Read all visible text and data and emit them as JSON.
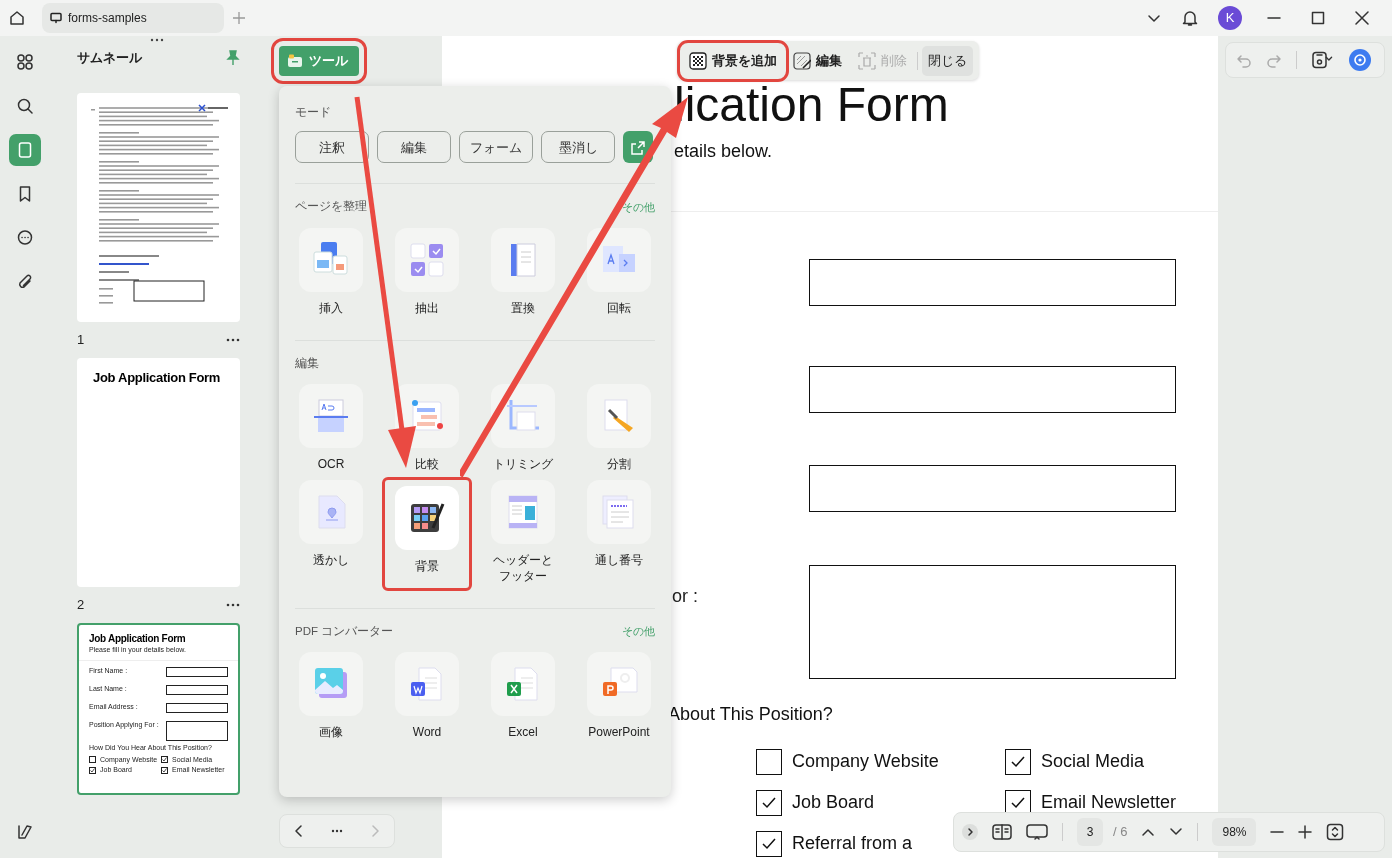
{
  "title_bar": {
    "tab": "forms-samples",
    "avatar": "K"
  },
  "left_rail": [
    {
      "kind": "apps",
      "selected": false
    },
    {
      "kind": "search",
      "selected": false
    },
    {
      "kind": "pages",
      "selected": true
    },
    {
      "kind": "bookmark",
      "selected": false
    },
    {
      "kind": "comment",
      "selected": false
    },
    {
      "kind": "attachment",
      "selected": false
    }
  ],
  "thumbnails": {
    "title": "サムネール",
    "pages": [
      {
        "kind": "contract",
        "number": "1",
        "selected": false
      },
      {
        "kind": "title",
        "number": "2",
        "selected": false,
        "heading": "Job Application Form"
      },
      {
        "kind": "form",
        "selected": true,
        "heading": "Job Application Form",
        "subtitle": "Please fill in your details below.",
        "labels": [
          "First Name :",
          "Last Name :",
          "Email Address :",
          "Position Applying For :"
        ],
        "question": "How Did You Hear About This Position?",
        "options": [
          {
            "label": "Company Website",
            "checked": false
          },
          {
            "label": "Social Media",
            "checked": true
          },
          {
            "label": "Job Board",
            "checked": true
          },
          {
            "label": "Email Newsletter",
            "checked": true
          }
        ]
      }
    ]
  },
  "tool_button": {
    "label": "ツール",
    "highlighted": true
  },
  "tool_panel": {
    "mode_title": "モード",
    "modes": [
      {
        "kind": "text",
        "label": "注釈"
      },
      {
        "kind": "text",
        "label": "編集"
      },
      {
        "kind": "text",
        "label": "フォーム"
      },
      {
        "kind": "text",
        "label": "墨消し"
      },
      {
        "kind": "export"
      }
    ],
    "sections": [
      {
        "title": "ページを整理",
        "more": "その他",
        "tools": [
          {
            "kind": "insert",
            "label": "挿入",
            "highlighted": false
          },
          {
            "kind": "extract",
            "label": "抽出",
            "highlighted": false
          },
          {
            "kind": "replace",
            "label": "置換",
            "highlighted": false
          },
          {
            "kind": "rotate",
            "label": "回転",
            "highlighted": false
          }
        ]
      },
      {
        "title": "編集",
        "tools": [
          {
            "kind": "ocr",
            "label": "OCR",
            "highlighted": false
          },
          {
            "kind": "compare",
            "label": "比較",
            "highlighted": false
          },
          {
            "kind": "crop",
            "label": "トリミング",
            "highlighted": false
          },
          {
            "kind": "split",
            "label": "分割",
            "highlighted": false
          },
          {
            "kind": "watermark",
            "label": "透かし",
            "highlighted": false
          },
          {
            "kind": "background",
            "label": "背景",
            "highlighted": true
          },
          {
            "kind": "header",
            "label": "ヘッダーとフッター",
            "highlighted": false
          },
          {
            "kind": "numbering",
            "label": "通し番号",
            "highlighted": false
          }
        ]
      },
      {
        "title": "PDF コンバーター",
        "more": "その他",
        "tools": [
          {
            "kind": "image",
            "label": "画像",
            "highlighted": false
          },
          {
            "kind": "word",
            "label": "Word",
            "highlighted": false
          },
          {
            "kind": "excel",
            "label": "Excel",
            "highlighted": false
          },
          {
            "kind": "ppt",
            "label": "PowerPoint",
            "highlighted": false
          }
        ]
      }
    ]
  },
  "pager": {
    "next_disabled": true
  },
  "edit_toolbar": [
    {
      "kind": "add",
      "label": "背景を追加",
      "highlighted": true,
      "disabled": false
    },
    {
      "kind": "edit",
      "label": "編集",
      "highlighted": false,
      "disabled": false
    },
    {
      "kind": "delete",
      "label": "削除",
      "highlighted": false,
      "disabled": true
    },
    {
      "kind": "close",
      "label": "閉じる",
      "highlighted": false,
      "disabled": false
    }
  ],
  "right_toolbar": {
    "undo_disabled": true,
    "redo_disabled": true
  },
  "document": {
    "title": "lication Form",
    "subtitle": "etails below.",
    "fields": [
      {
        "kind": "single"
      },
      {
        "kind": "single"
      },
      {
        "kind": "single"
      },
      {
        "kind": "multi",
        "label": "or :"
      }
    ],
    "question": "About This Position?",
    "options": [
      {
        "label": "Company Website",
        "checked": false
      },
      {
        "label": "Social Media",
        "checked": true
      },
      {
        "label": "Job Board",
        "checked": true
      },
      {
        "label": "Email Newsletter",
        "checked": true
      },
      {
        "label": "Referral from a",
        "checked": true
      }
    ]
  },
  "bottom_bar": {
    "page": "3",
    "total": "/ 6",
    "zoom": "98%"
  }
}
